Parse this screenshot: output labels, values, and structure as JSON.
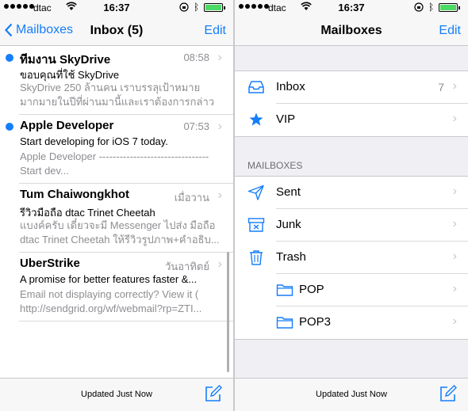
{
  "status": {
    "carrier": "dtac",
    "time": "16:37"
  },
  "left": {
    "nav": {
      "back_label": "Mailboxes",
      "title": "Inbox (5)",
      "edit_label": "Edit"
    },
    "messages": [
      {
        "sender": "ทีมงาน SkyDrive",
        "date": "08:58",
        "subject": "ขอบคุณที่ใช้ SkyDrive",
        "preview": "SkyDrive 250 ล้านคน เราบรรลุเป้าหมาย มากมายในปีที่ผ่านมานี้และเราต้องการกล่าวขอ...",
        "unread": true
      },
      {
        "sender": "Apple Developer",
        "date": "07:53",
        "subject": "Start developing for iOS 7 today.",
        "preview": "Apple Developer -------------------------------- Start dev...",
        "unread": true
      },
      {
        "sender": "Tum Chaiwongkhot",
        "date": "เมื่อวาน",
        "subject": "รีวิวมือถือ dtac Trinet Cheetah",
        "preview": "แบงค์ครับ เดี๋ยวจะมี Messenger ไปส่ง มือถือ dtac Trinet Cheetah ให้รีวิวรูปภาพ+คำอธิบ...",
        "unread": false
      },
      {
        "sender": "UberStrike",
        "date": "วันอาทิตย์",
        "subject": "A promise for better features faster &...",
        "preview": "Email not displaying correctly? View it ( http://sendgrid.org/wf/webmail?rp=ZTI...",
        "unread": false
      }
    ],
    "toolbar": {
      "updated": "Updated Just Now"
    }
  },
  "right": {
    "nav": {
      "title": "Mailboxes",
      "edit_label": "Edit"
    },
    "top_boxes": [
      {
        "label": "Inbox",
        "count": "7",
        "icon": "inbox-icon"
      },
      {
        "label": "VIP",
        "count": "",
        "icon": "star-icon"
      }
    ],
    "section_header": "MAILBOXES",
    "boxes": [
      {
        "label": "Sent",
        "icon": "sent-icon"
      },
      {
        "label": "Junk",
        "icon": "junk-icon"
      },
      {
        "label": "Trash",
        "icon": "trash-icon"
      },
      {
        "label": "POP",
        "icon": "folder-icon"
      },
      {
        "label": "POP3",
        "icon": "folder-icon"
      }
    ],
    "toolbar": {
      "updated": "Updated Just Now"
    }
  },
  "colors": {
    "accent": "#157efb",
    "battery": "#4cd964",
    "secondary_text": "#8e8e93",
    "grouped_bg": "#efeff4"
  }
}
